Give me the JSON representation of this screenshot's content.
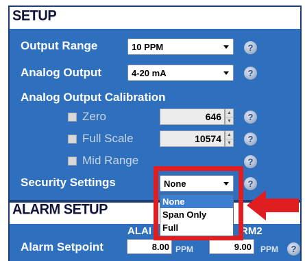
{
  "setup": {
    "title": "SETUP",
    "output_range": {
      "label": "Output Range",
      "value": "10 PPM"
    },
    "analog_output": {
      "label": "Analog Output",
      "value": "4-20 mA"
    },
    "calibration": {
      "label": "Analog Output Calibration",
      "zero": {
        "label": "Zero",
        "value": "646"
      },
      "full_scale": {
        "label": "Full Scale",
        "value": "10574"
      },
      "mid_range": {
        "label": "Mid Range"
      }
    },
    "security": {
      "label": "Security Settings",
      "value": "None",
      "options": [
        "None",
        "Span Only",
        "Full"
      ],
      "highlighted_option": "None"
    },
    "help_glyph": "?"
  },
  "alarm_setup": {
    "title": "ALARM SETUP",
    "col1_header_partial": "ALAI",
    "col2_header_partial": "RM2",
    "setpoint": {
      "label": "Alarm Setpoint",
      "alarm1": "8.00",
      "alarm2": "9.00",
      "unit": "PPM"
    }
  },
  "colors": {
    "panel": "#2e70bd",
    "header_text": "#10143a",
    "highlight_border": "#e01e22",
    "arrow": "#e01e22",
    "selected_option": "#3c7fd1"
  },
  "icons": [
    "help-icon",
    "dropdown-arrow-icon",
    "spinner-icon",
    "checkbox-icon",
    "red-arrow-icon"
  ]
}
